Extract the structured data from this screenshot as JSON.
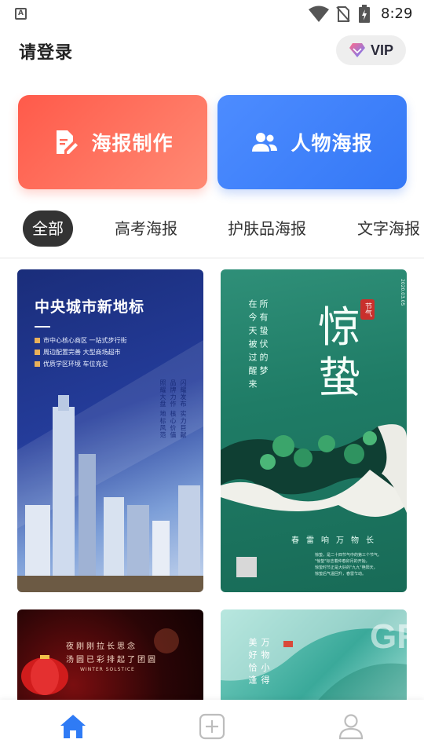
{
  "status_bar": {
    "time": "8:29",
    "app_indicator": "A",
    "icons": [
      "wifi-icon",
      "no-sim-icon",
      "battery-charging-icon"
    ]
  },
  "header": {
    "login_title": "请登录",
    "vip_label": "VIP",
    "vip_icon": "gem-icon"
  },
  "actions": {
    "poster_make": {
      "label": "海报制作",
      "icon": "edit-document-icon",
      "color": "#ff6a5a"
    },
    "people_poster": {
      "label": "人物海报",
      "icon": "people-icon",
      "color": "#3d82f8"
    }
  },
  "tabs": [
    {
      "label": "全部",
      "active": true
    },
    {
      "label": "高考海报",
      "active": false
    },
    {
      "label": "护肤品海报",
      "active": false
    },
    {
      "label": "文字海报",
      "active": false
    }
  ],
  "templates": [
    {
      "title": "中央城市新地标",
      "lines": [
        "市中心核心商区 一站式步行街",
        "周边配置完善 大型商场超市",
        "优质学区环境 车位充足"
      ],
      "vertical_texts": [
        "闪耀发布 实力巨献",
        "品牌力作 核心价值",
        "照耀大盘 地标风范"
      ]
    },
    {
      "title": "惊蛰",
      "seal": "节气",
      "date": "2020.03.05",
      "vertical_texts": [
        "所有蛰伏的梦",
        "在今天被过醒来"
      ],
      "subtitle": "春雷响万物长",
      "small_lines": [
        "惊蛰，是二十四节气中的第三个节气。",
        "\"惊蛰\"标志着仲春卯月的开始，",
        "惊蛰时节正是大好的\"九九\"艳阳天，",
        "惊蛰后气温回升，春雷乍动。"
      ]
    },
    {
      "lines": [
        "夜刚刚拉长思念",
        "汤圆已彩排起了团圆"
      ],
      "en_text": "WINTER SOLSTICE"
    },
    {
      "vertical_texts": [
        "美好恰逢",
        "万物小得"
      ],
      "watermark": "GR"
    }
  ],
  "bottom_nav": [
    {
      "name": "home",
      "icon": "home-icon",
      "active": true,
      "color": "#2f7bf5"
    },
    {
      "name": "create",
      "icon": "add-square-icon",
      "active": false,
      "color": "#bdbdbd"
    },
    {
      "name": "profile",
      "icon": "user-icon",
      "active": false,
      "color": "#bdbdbd"
    }
  ]
}
